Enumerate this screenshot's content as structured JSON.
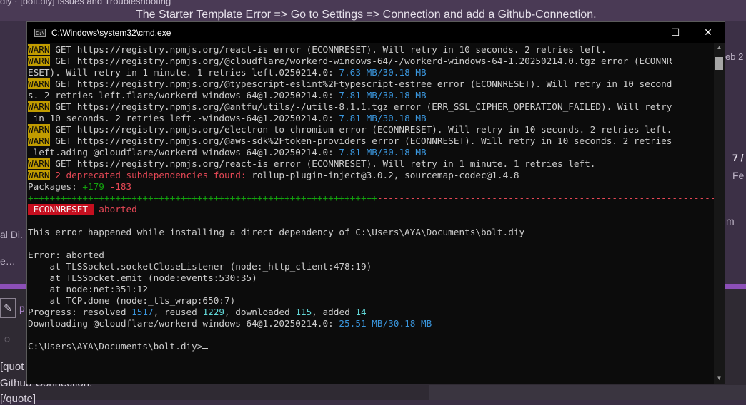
{
  "background": {
    "tab_text": "diy · [bolt.diy] Issues and Troubleshooting",
    "banner": "The Starter Template Error => Go to Settings => Connection and add a Github-Connection.",
    "right_fragments": [
      "eb 2",
      "7 /",
      "Fe",
      "m"
    ],
    "left_fragments": [
      "al Di.",
      "e…"
    ],
    "side_p": "p",
    "quote_lines": [
      "[quot",
      "Github-Connection.",
      "[/quote]"
    ]
  },
  "window": {
    "title": "C:\\Windows\\system32\\cmd.exe",
    "icon_text": "C:\\",
    "minimize": "—",
    "maximize": "☐",
    "close": "✕"
  },
  "console": {
    "warn_label": "WARN",
    "w1": " GET https://registry.npmjs.org/react-is error (ECONNRESET). Will retry in 10 seconds. 2 retries left.",
    "w2": " GET https://registry.npmjs.org/@cloudflare/workerd-windows-64/-/workerd-windows-64-1.20250214.0.tgz error (ECONNR",
    "w2b": "ESET). Will retry in 1 minute. 1 retries left.0250214.0: ",
    "w2b_mb": "7.63",
    "w2b_tot": " MB/30.18 MB",
    "w3": " GET https://registry.npmjs.org/@typescript-eslint%2Ftypescript-estree error (ECONNRESET). Will retry in 10 second",
    "w3b": "s. 2 retries left.flare/workerd-windows-64@1.20250214.0: ",
    "w3b_mb": "7.81",
    "w3b_tot": " MB/30.18 MB",
    "w4": " GET https://registry.npmjs.org/@antfu/utils/-/utils-8.1.1.tgz error (ERR_SSL_CIPHER_OPERATION_FAILED). Will retry",
    "w4b": " in 10 seconds. 2 retries left.-windows-64@1.20250214.0: ",
    "w4b_mb": "7.81",
    "w4b_tot": " MB/30.18 MB",
    "w5": " GET https://registry.npmjs.org/electron-to-chromium error (ECONNRESET). Will retry in 10 seconds. 2 retries left.",
    "w6": " GET https://registry.npmjs.org/@aws-sdk%2Ftoken-providers error (ECONNRESET). Will retry in 10 seconds. 2 retries",
    "w6b": " left.ading @cloudflare/workerd-windows-64@1.20250214.0: ",
    "w6b_mb": "7.81",
    "w6b_tot": " MB/30.18 MB",
    "w7": " GET https://registry.npmjs.org/react-is error (ECONNRESET). Will retry in 1 minute. 1 retries left.",
    "w8_red": " 2 deprecated subdependencies found:",
    "w8_rest": " rollup-plugin-inject@3.0.2, sourcemap-codec@1.4.8",
    "packages_label": "Packages: ",
    "packages_add": "+179",
    "packages_del": " -183",
    "bar_plus": "++++++++++++++++++++++++++++++++++++++++++++++++++++++++++++++++",
    "bar_minus": "---------------------------------------------------------------------------------------------------------",
    "err_label": " ECONNRESET ",
    "err_msg": " aborted",
    "direct_dep": "This error happened while installing a direct dependency of C:\\Users\\AYA\\Documents\\bolt.diy",
    "error_line": "Error: aborted",
    "stack1": "    at TLSSocket.socketCloseListener (node:_http_client:478:19)",
    "stack2": "    at TLSSocket.emit (node:events:530:35)",
    "stack3": "    at node:net:351:12",
    "stack4": "    at TCP.done (node:_tls_wrap:650:7)",
    "progress_label": "Progress: resolved ",
    "resolved": "1517",
    "reused_label": ", reused ",
    "reused": "1229",
    "downloaded_label": ", downloaded ",
    "downloaded": "115",
    "added_label": ", added ",
    "added": "14",
    "downloading_label": "Downloading @cloudflare/workerd-windows-64@1.20250214.0: ",
    "dl_mb": "25.51",
    "dl_tot": " MB/30.18 MB",
    "prompt": "C:\\Users\\AYA\\Documents\\bolt.diy>"
  },
  "scrollbar": {
    "up": "▲",
    "down": "▼"
  }
}
